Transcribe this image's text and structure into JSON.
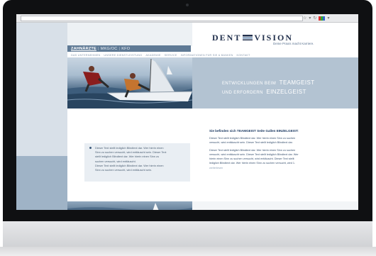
{
  "browser": {
    "url": ""
  },
  "site": {
    "logo": {
      "part1": "DENT",
      "part2": "VISION"
    },
    "tagline": "Deine Praxis macht Karriere.",
    "nav_primary": [
      "ZAHNÄRZTE",
      "|",
      "MKG/OC",
      "|",
      "KFO"
    ],
    "nav_secondary": [
      "DAS UNTERNEHMEN",
      "UNSERE DIENSTLEISTUNG",
      "AKADEMIE",
      "SERVICE",
      "INFORMATIONEN FÜR SIE & BANKEN",
      "KONTAKT"
    ],
    "hero": {
      "line1_small": "ENTWICKLUNGEN BEIM",
      "line1_big": "TEAMGEIST",
      "line2_small": "UND ERFORDERN",
      "line2_big": "EINZELGEIST"
    },
    "quote_lines": [
      "Dieser Text stellt lediglich Blindtext dar. Wer hierin einen",
      "Sinn zu suchen versucht, wird enttäuscht sein. Dieser Text",
      "stellt lediglich Blindtext dar. Wer hierin einen Sinn zu",
      "suchen versucht, wird enttäuscht.",
      "Dieser Text stellt lediglich Blindtext dar. Wer hierin einen",
      "Sinn zu suchen versucht, wird enttäuscht sein."
    ],
    "article": {
      "title": "Sie befinden sich TEAMGEIST Seite Gallen EINZELGEIST:",
      "paragraphs": [
        "Dieser Text stellt lediglich Blindtext dar. Wer hierin einen Sinn zu suchen versucht, wird enttäuscht sein. Dieser Text stellt lediglich Blindtext dar.",
        "Dieser Text stellt lediglich Blindtext dar. Wer hierin einen Sinn zu suchen versucht, wird enttäuscht sein. Dieser Text stellt lediglich Blindtext dar. Wer hierin einen Sinn zu suchen versucht, wird enttäuscht. Dieser Text stellt lediglich Blindtext dar. Wer hierin einen Sinn zu suchen versucht, wird 1."
      ],
      "more_link": "weiterlesen"
    }
  },
  "icons": {
    "star": "star-icon",
    "reload": "reload-icon",
    "favicon": "favicon-icon"
  },
  "colors": {
    "brand_navy": "#23314d",
    "nav_bar": "#5f7a95",
    "hero_band": "#b3c3d2"
  }
}
